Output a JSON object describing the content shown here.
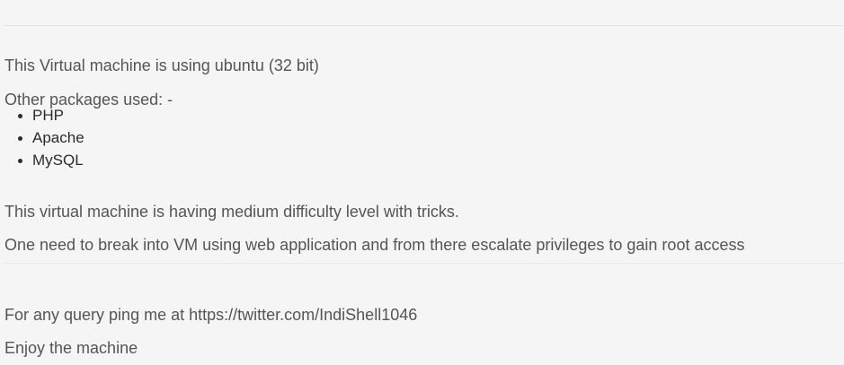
{
  "content": {
    "os_line": "This Virtual machine is using ubuntu (32 bit)",
    "packages_intro": "Other packages used: -",
    "packages": [
      {
        "name": "PHP"
      },
      {
        "name": "Apache"
      },
      {
        "name": "MySQL"
      }
    ],
    "difficulty_line": "This virtual machine is having medium difficulty level with tricks.",
    "goal_line": "One need to break into VM using web application and from there escalate privileges to gain root access"
  },
  "footer": {
    "contact_line": "For any query ping me at https://twitter.com/IndiShell1046",
    "closing_line": "Enjoy the machine"
  }
}
